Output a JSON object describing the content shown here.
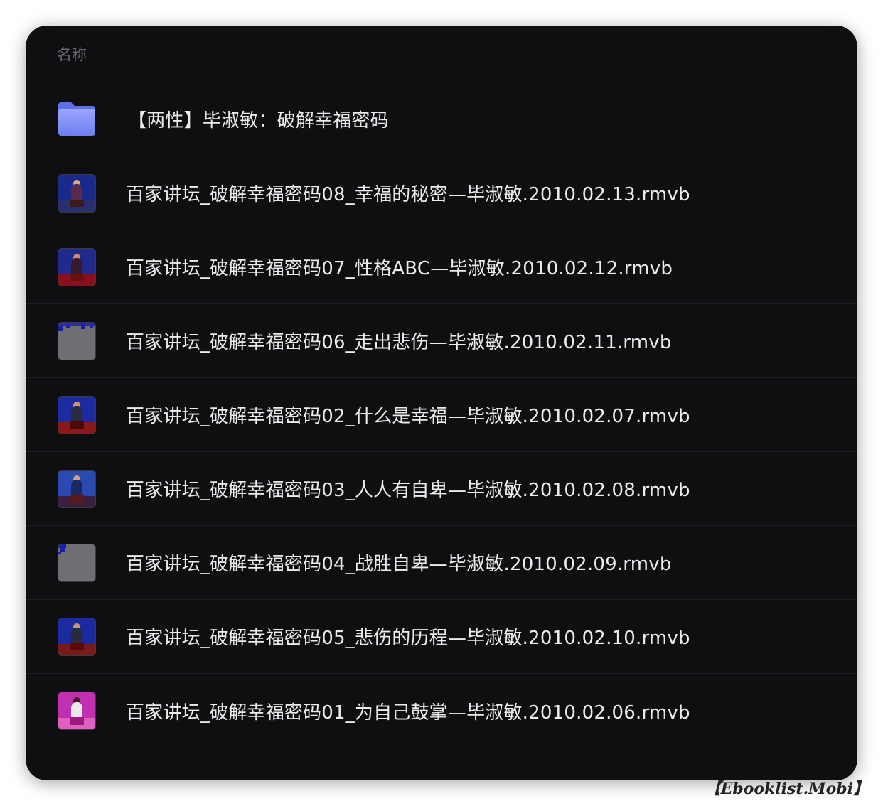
{
  "header": {
    "column_name": "名称"
  },
  "folder": {
    "name": "【两性】毕淑敏：破解幸福密码",
    "icon": "folder-icon"
  },
  "files": [
    {
      "name": "百家讲坛_破解幸福密码08_幸福的秘密—毕淑敏.2010.02.13.rmvb",
      "thumb": "video-thumbnail-icon"
    },
    {
      "name": "百家讲坛_破解幸福密码07_性格ABC—毕淑敏.2010.02.12.rmvb",
      "thumb": "video-thumbnail-icon"
    },
    {
      "name": "百家讲坛_破解幸福密码06_走出悲伤—毕淑敏.2010.02.11.rmvb",
      "thumb": "video-thumbnail-icon"
    },
    {
      "name": "百家讲坛_破解幸福密码02_什么是幸福—毕淑敏.2010.02.07.rmvb",
      "thumb": "video-thumbnail-icon"
    },
    {
      "name": "百家讲坛_破解幸福密码03_人人有自卑—毕淑敏.2010.02.08.rmvb",
      "thumb": "video-thumbnail-icon"
    },
    {
      "name": "百家讲坛_破解幸福密码04_战胜自卑—毕淑敏.2010.02.09.rmvb",
      "thumb": "video-thumbnail-icon"
    },
    {
      "name": "百家讲坛_破解幸福密码05_悲伤的历程—毕淑敏.2010.02.10.rmvb",
      "thumb": "video-thumbnail-icon"
    },
    {
      "name": "百家讲坛_破解幸福密码01_为自己鼓掌—毕淑敏.2010.02.06.rmvb",
      "thumb": "video-thumbnail-icon"
    }
  ],
  "watermark": "【Ebooklist.Mobi】",
  "colors": {
    "background": "#0f0f12",
    "text": "#ececef",
    "header_text": "#6a6a70",
    "folder": "#7b8cf5"
  }
}
